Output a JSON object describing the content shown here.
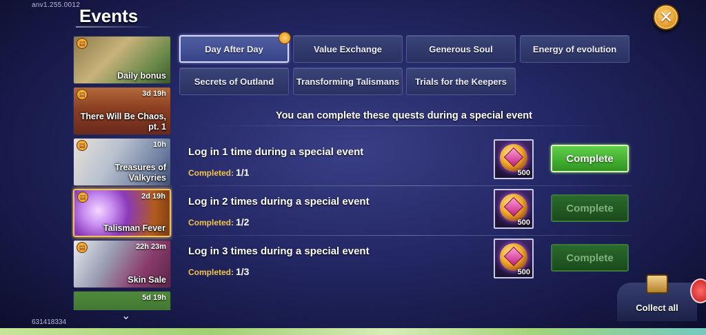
{
  "app": {
    "version": "anv1.255.0012",
    "player_id": "631418334",
    "title": "Events"
  },
  "sidebar": {
    "events": [
      {
        "label": "Daily bonus",
        "timer": ""
      },
      {
        "label": "There Will Be Chaos, pt. 1",
        "timer": "3d 19h"
      },
      {
        "label": "Treasures of Valkyries",
        "timer": "10h"
      },
      {
        "label": "Talisman Fever",
        "timer": "2d 19h"
      },
      {
        "label": "Skin Sale",
        "timer": "22h 23m"
      },
      {
        "label": "",
        "timer": "5d 19h"
      }
    ]
  },
  "tabs": [
    {
      "label": "Day After Day",
      "active": true
    },
    {
      "label": "Value Exchange"
    },
    {
      "label": "Generous Soul"
    },
    {
      "label": "Energy of evolution"
    },
    {
      "label": "Secrets of Outland"
    },
    {
      "label": "Transforming Talismans"
    },
    {
      "label": "Trials for the Keepers"
    }
  ],
  "quests": {
    "header": "You can complete these quests during a special event",
    "progress_label": "Completed:",
    "items": [
      {
        "title": "Log in 1 time during a special event",
        "progress": "1/1",
        "reward_qty": "500",
        "button": "Complete",
        "enabled": true
      },
      {
        "title": "Log in 2 times during a special event",
        "progress": "1/2",
        "reward_qty": "500",
        "button": "Complete",
        "enabled": false
      },
      {
        "title": "Log in 3 times during a special event",
        "progress": "1/3",
        "reward_qty": "500",
        "button": "Complete",
        "enabled": false
      }
    ]
  },
  "collect_all": {
    "label": "Collect all"
  },
  "icons": {
    "close": "close-icon",
    "gift": "gift-icon",
    "scroll": "chevron-down-icon",
    "reward": "emerald-coin-icon",
    "collect": "chest-icon"
  },
  "colors": {
    "accent_gold": "#f2c449",
    "complete_green": "#3fae2a",
    "panel_blue": "#2a3163"
  }
}
